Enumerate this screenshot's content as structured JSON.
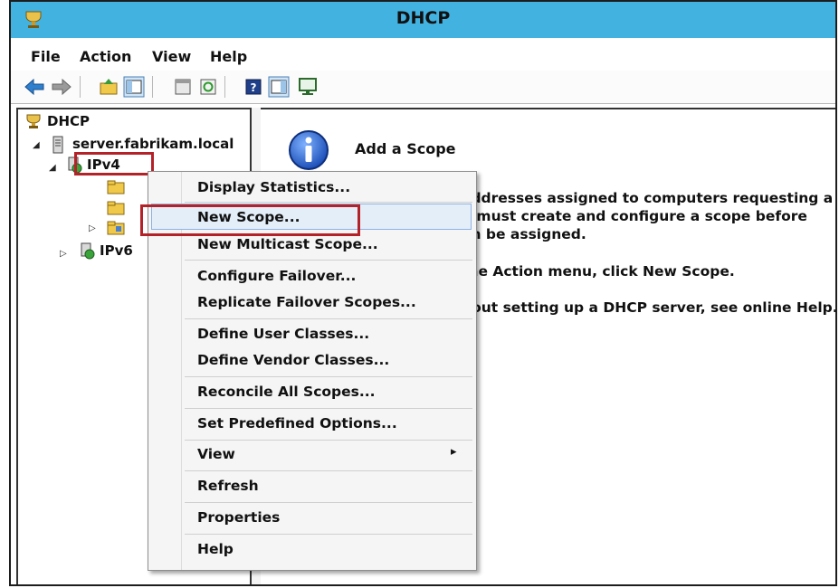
{
  "window": {
    "title": "DHCP"
  },
  "menubar": [
    "File",
    "Action",
    "View",
    "Help"
  ],
  "tree": {
    "root": "DHCP",
    "server": "server.fabrikam.local",
    "ipv4": "IPv4",
    "ipv6": "IPv6"
  },
  "info_panel": {
    "title": "Add a Scope",
    "lines": [
      "addresses assigned to computers requesting a",
      "u must create and configure a scope before",
      "an be assigned.",
      "the Action menu, click New Scope.",
      "bout setting up a DHCP server, see online Help."
    ]
  },
  "context_menu": {
    "items": [
      "Display Statistics...",
      "New Scope...",
      "New Multicast Scope...",
      "Configure Failover...",
      "Replicate Failover Scopes...",
      "Define User Classes...",
      "Define Vendor Classes...",
      "Reconcile All Scopes...",
      "Set Predefined Options...",
      "View",
      "Refresh",
      "Properties",
      "Help"
    ],
    "highlighted": "New Scope...",
    "submenu_arrow": "▸"
  },
  "colors": {
    "titlebar": "#42b2e0",
    "highlight_box": "#b42229",
    "menu_hover": "#e4eef9"
  }
}
